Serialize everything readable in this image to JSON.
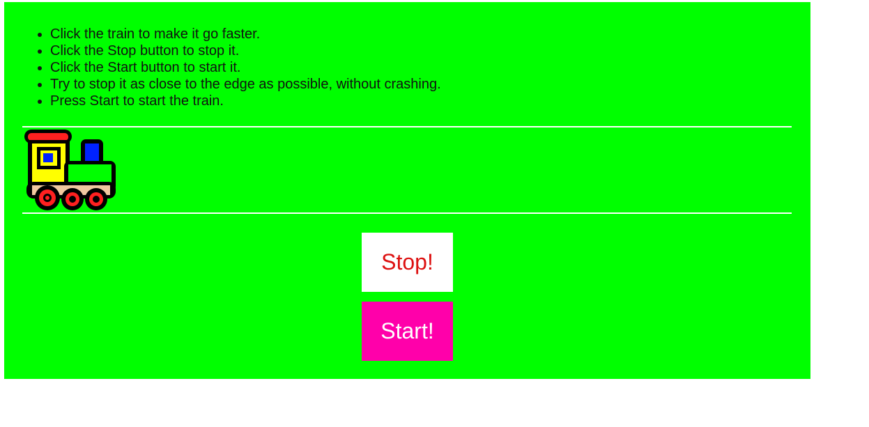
{
  "instructions": [
    "Click the train to make it go faster.",
    "Click the Stop button to stop it.",
    "Click the Start button to start it.",
    "Try to stop it as close to the edge as possible, without crashing.",
    "Press Start to start the train."
  ],
  "buttons": {
    "stop_label": "Stop!",
    "start_label": "Start!"
  },
  "colors": {
    "panel_background": "#00ff00",
    "stop_button_background": "#ffffff",
    "stop_button_text": "#dd1111",
    "start_button_background": "#ff00aa",
    "start_button_text": "#ffffff"
  },
  "icons": {
    "train": "train-icon"
  }
}
